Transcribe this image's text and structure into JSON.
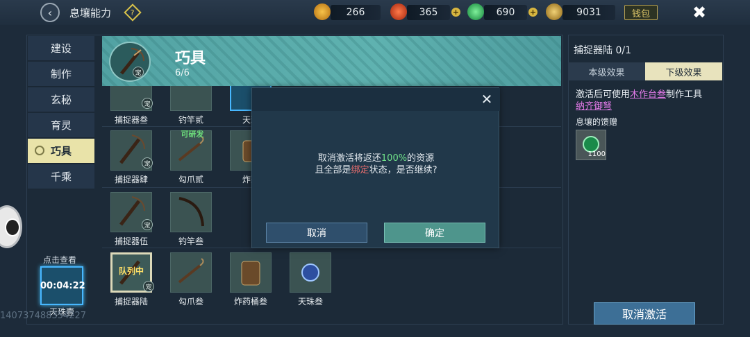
{
  "topbar": {
    "title": "息壤能力",
    "help_icon": "?",
    "resources": [
      {
        "icon": "gold-ingot-icon",
        "value": "266"
      },
      {
        "icon": "red-orb-icon",
        "value": "365"
      },
      {
        "icon": "jade-icon",
        "value": "690"
      },
      {
        "icon": "leaf-coin-icon",
        "value": "9031"
      }
    ],
    "wallet_label": "钱包"
  },
  "sidebar": {
    "items": [
      {
        "label": "建设"
      },
      {
        "label": "制作"
      },
      {
        "label": "玄秘"
      },
      {
        "label": "育灵"
      },
      {
        "label": "巧具"
      },
      {
        "label": "千乘"
      }
    ]
  },
  "banner": {
    "title": "巧具",
    "count": "6/6",
    "badge": "宠"
  },
  "items": [
    {
      "label": "捕捉器叁"
    },
    {
      "label": "钓竿贰"
    },
    {
      "label": "天珠"
    },
    {
      "label": "捕捉器肆"
    },
    {
      "label": "勾爪贰",
      "tag": "可研发"
    },
    {
      "label": "炸药"
    },
    {
      "label": "捕捉器伍"
    },
    {
      "label": "钓竿叁"
    },
    {
      "label": "捕捉器陆",
      "queue": "队列中"
    },
    {
      "label": "勾爪叁"
    },
    {
      "label": "炸药桶叁"
    },
    {
      "label": "天珠叁"
    }
  ],
  "check": {
    "text": "点击查看",
    "time": "00:04:22",
    "name": "天珠壹"
  },
  "watermark": "140737488354227",
  "right": {
    "title": "捕捉器陆 0/1",
    "tab_current": "本级效果",
    "tab_next": "下级效果",
    "desc_prefix": "激活后可使用",
    "desc_link1": "木作台叁",
    "desc_suffix": "制作工具",
    "desc_link2": "纳齐御弩",
    "gift_title": "息壤的馈赠",
    "gift_count": "1100",
    "deactivate": "取消激活"
  },
  "modal": {
    "line1_prefix": "取消激活将返还",
    "line1_pct": "100%",
    "line1_suffix": "的资源",
    "line2_prefix": "且全部是",
    "line2_bind": "绑定",
    "line2_suffix": "状态，是否继续?",
    "cancel": "取消",
    "confirm": "确定"
  }
}
